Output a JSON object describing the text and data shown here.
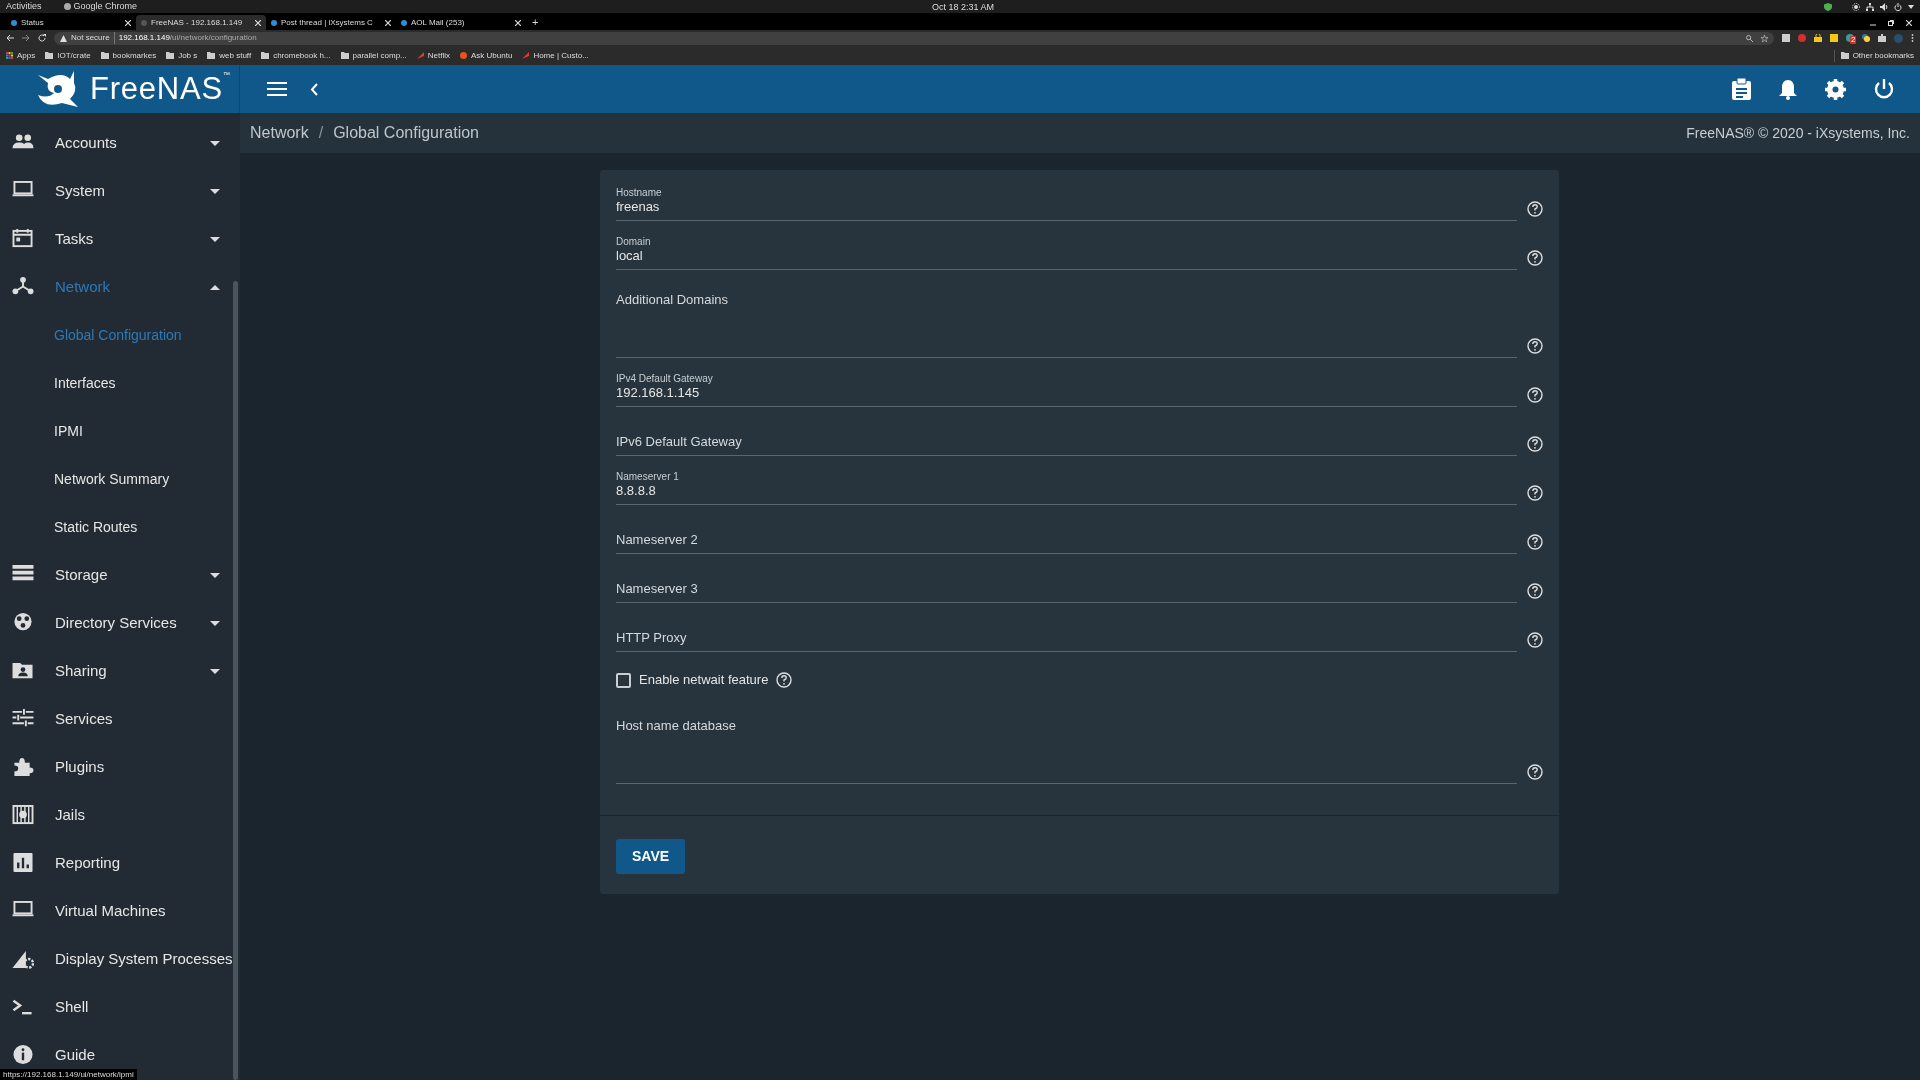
{
  "system_bar": {
    "activities": "Activities",
    "app_menu": "Google Chrome",
    "clock": "Oct 18  2:31 AM"
  },
  "browser": {
    "tabs": [
      {
        "title": "Status",
        "selected": false
      },
      {
        "title": "FreeNAS - 192.168.1.149",
        "selected": true
      },
      {
        "title": "Post thread | iXsystems C",
        "selected": false
      },
      {
        "title": "AOL Mail (253)",
        "selected": false
      }
    ],
    "new_tab": "+",
    "address": {
      "security": "Not secure",
      "host": "192.168.1.149",
      "path": "/ui/network/configuration"
    },
    "extension_badge": "2",
    "bookmarks": [
      "Apps",
      "IOT/crate",
      "bookmarkes",
      "Job s",
      "web stuff",
      "chromebook h...",
      "parallel comp...",
      "Netflix",
      "Ask Ubuntu",
      "Home | Custo..."
    ],
    "other_bookmarks": "Other bookmarks",
    "status_url": "https://192.168.1.149/ui/network/ipmi"
  },
  "app": {
    "logo": "FreeNAS",
    "logo_mark": "™",
    "breadcrumb": [
      "Network",
      "Global Configuration"
    ],
    "breadcrumb_separator": "/",
    "copyright": "FreeNAS® © 2020 - iXsystems, Inc.",
    "sidebar": [
      {
        "label": "Accounts",
        "expanded": false,
        "selected": false
      },
      {
        "label": "System",
        "expanded": false,
        "selected": false
      },
      {
        "label": "Tasks",
        "expanded": false,
        "selected": false
      },
      {
        "label": "Network",
        "expanded": true,
        "selected": true,
        "children": [
          {
            "label": "Global Configuration",
            "selected": true
          },
          {
            "label": "Interfaces",
            "selected": false
          },
          {
            "label": "IPMI",
            "selected": false
          },
          {
            "label": "Network Summary",
            "selected": false
          },
          {
            "label": "Static Routes",
            "selected": false
          }
        ]
      },
      {
        "label": "Storage",
        "expanded": false,
        "selected": false
      },
      {
        "label": "Directory Services",
        "expanded": false,
        "selected": false
      },
      {
        "label": "Sharing",
        "expanded": false,
        "selected": false
      },
      {
        "label": "Services",
        "selected": false
      },
      {
        "label": "Plugins",
        "selected": false
      },
      {
        "label": "Jails",
        "selected": false
      },
      {
        "label": "Reporting",
        "selected": false
      },
      {
        "label": "Virtual Machines",
        "selected": false
      },
      {
        "label": "Display System Processes",
        "selected": false
      },
      {
        "label": "Shell",
        "selected": false
      },
      {
        "label": "Guide",
        "selected": false
      }
    ],
    "form": {
      "fields": [
        {
          "kind": "text",
          "label": "Hostname",
          "value": "freenas"
        },
        {
          "kind": "text",
          "label": "Domain",
          "value": "local"
        },
        {
          "kind": "textarea",
          "label": "Additional Domains"
        },
        {
          "kind": "text",
          "label": "IPv4 Default Gateway",
          "value": "192.168.1.145"
        },
        {
          "kind": "text",
          "label": "IPv6 Default Gateway"
        },
        {
          "kind": "text",
          "label": "Nameserver 1",
          "value": "8.8.8.8"
        },
        {
          "kind": "text",
          "label": "Nameserver 2"
        },
        {
          "kind": "text",
          "label": "Nameserver 3"
        },
        {
          "kind": "text",
          "label": "HTTP Proxy"
        },
        {
          "kind": "checkbox",
          "label": "Enable netwait feature",
          "checked": false
        },
        {
          "kind": "textarea",
          "label": "Host name database"
        }
      ],
      "save": "SAVE"
    }
  }
}
